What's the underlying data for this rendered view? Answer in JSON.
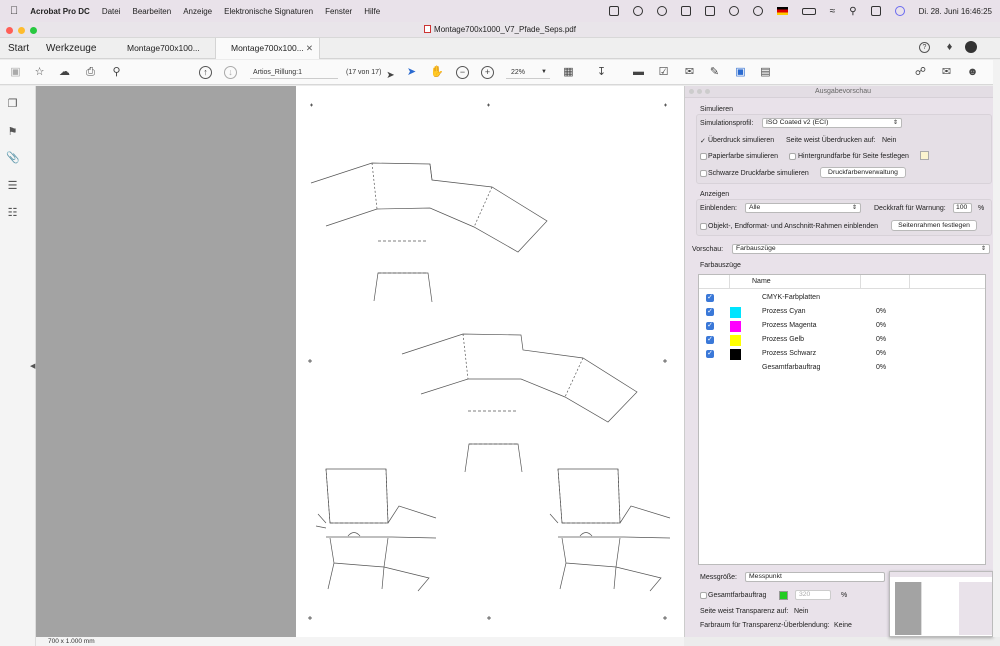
{
  "menubar": {
    "app": "Acrobat Pro DC",
    "items": [
      "Datei",
      "Bearbeiten",
      "Anzeige",
      "Elektronische Signaturen",
      "Fenster",
      "Hilfe"
    ],
    "clock": "Di. 28. Juni  16:46:25"
  },
  "window": {
    "title": "Montage700x1000_V7_Pfade_Seps.pdf"
  },
  "tabs": {
    "start": "Start",
    "tools": "Werkzeuge",
    "doc1": "Montage700x100...",
    "doc2": "Montage700x100..."
  },
  "toolbar": {
    "page_label": "Artios_Rillung:1",
    "page_count": "(17 von 17)",
    "zoom": "22%"
  },
  "status": {
    "dimensions": "700 x 1.000 mm"
  },
  "panel": {
    "title": "Ausgabevorschau",
    "simulate": {
      "heading": "Simulieren",
      "profile_label": "Simulationsprofil:",
      "profile_value": "ISO Coated v2 (ECI)",
      "overprint_label": "Überdruck simulieren",
      "overprint_checked": "✓",
      "page_overprint_label": "Seite weist Überdrucken auf:",
      "page_overprint_value": "Nein",
      "paper_label": "Papierfarbe simulieren",
      "bg_label": "Hintergrundfarbe für Seite festlegen",
      "black_label": "Schwarze Druckfarbe simulieren",
      "inkmanager_button": "Druckfarbenverwaltung"
    },
    "display": {
      "heading": "Anzeigen",
      "show_label": "Einblenden:",
      "show_value": "Alle",
      "opacity_label": "Deckkraft für Warnung:",
      "opacity_value": "100",
      "opacity_unit": "%",
      "frames_label": "Objekt-, Endformat- und Anschnitt-Rahmen einblenden",
      "frames_button": "Seitenrahmen festlegen"
    },
    "preview_label": "Vorschau:",
    "preview_value": "Farbauszüge",
    "separations": {
      "heading": "Farbauszüge",
      "column_name": "Name",
      "rows": [
        {
          "name": "CMYK-Farbplatten",
          "value": "",
          "color": "",
          "checked": "✓"
        },
        {
          "name": "Prozess Cyan",
          "value": "0%",
          "color": "#00e5ff",
          "checked": "✓"
        },
        {
          "name": "Prozess Magenta",
          "value": "0%",
          "color": "#ff00ff",
          "checked": "✓"
        },
        {
          "name": "Prozess Gelb",
          "value": "0%",
          "color": "#ffff00",
          "checked": "✓"
        },
        {
          "name": "Prozess Schwarz",
          "value": "0%",
          "color": "#000000",
          "checked": "✓"
        },
        {
          "name": "Gesamtfarbauftrag",
          "value": "0%",
          "color": "",
          "checked": ""
        }
      ]
    },
    "measure_label": "Messgröße:",
    "measure_value": "Messpunkt",
    "total_ink_label": "Gesamtfarbauftrag",
    "total_ink_value": "320",
    "total_ink_unit": "%",
    "transparency_label": "Seite weist Transparenz auf:",
    "transparency_value": "Nein",
    "blend_label": "Farbraum für Transparenz-Überblendung:",
    "blend_value": "Keine"
  },
  "colors": {
    "accent": "#3a78d8",
    "close": "#ff5f57",
    "minimize": "#febc2e",
    "zoom": "#28c840",
    "total_ink_swatch": "#22cc22"
  }
}
